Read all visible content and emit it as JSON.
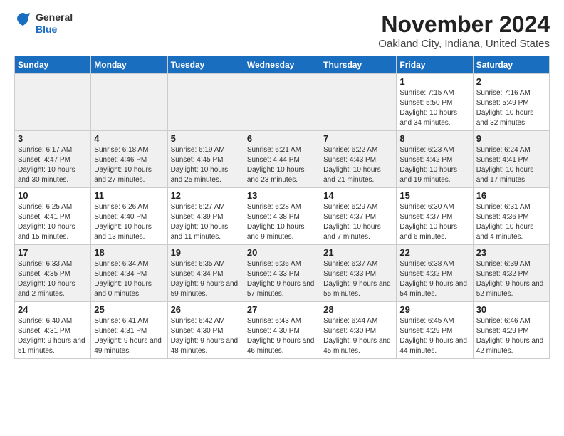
{
  "logo": {
    "line1": "General",
    "line2": "Blue"
  },
  "title": "November 2024",
  "location": "Oakland City, Indiana, United States",
  "days_of_week": [
    "Sunday",
    "Monday",
    "Tuesday",
    "Wednesday",
    "Thursday",
    "Friday",
    "Saturday"
  ],
  "weeks": [
    [
      {
        "day": "",
        "info": "",
        "empty": true
      },
      {
        "day": "",
        "info": "",
        "empty": true
      },
      {
        "day": "",
        "info": "",
        "empty": true
      },
      {
        "day": "",
        "info": "",
        "empty": true
      },
      {
        "day": "",
        "info": "",
        "empty": true
      },
      {
        "day": "1",
        "info": "Sunrise: 7:15 AM\nSunset: 5:50 PM\nDaylight: 10 hours\nand 34 minutes.",
        "empty": false
      },
      {
        "day": "2",
        "info": "Sunrise: 7:16 AM\nSunset: 5:49 PM\nDaylight: 10 hours\nand 32 minutes.",
        "empty": false
      }
    ],
    [
      {
        "day": "3",
        "info": "Sunrise: 6:17 AM\nSunset: 4:47 PM\nDaylight: 10 hours\nand 30 minutes.",
        "empty": false
      },
      {
        "day": "4",
        "info": "Sunrise: 6:18 AM\nSunset: 4:46 PM\nDaylight: 10 hours\nand 27 minutes.",
        "empty": false
      },
      {
        "day": "5",
        "info": "Sunrise: 6:19 AM\nSunset: 4:45 PM\nDaylight: 10 hours\nand 25 minutes.",
        "empty": false
      },
      {
        "day": "6",
        "info": "Sunrise: 6:21 AM\nSunset: 4:44 PM\nDaylight: 10 hours\nand 23 minutes.",
        "empty": false
      },
      {
        "day": "7",
        "info": "Sunrise: 6:22 AM\nSunset: 4:43 PM\nDaylight: 10 hours\nand 21 minutes.",
        "empty": false
      },
      {
        "day": "8",
        "info": "Sunrise: 6:23 AM\nSunset: 4:42 PM\nDaylight: 10 hours\nand 19 minutes.",
        "empty": false
      },
      {
        "day": "9",
        "info": "Sunrise: 6:24 AM\nSunset: 4:41 PM\nDaylight: 10 hours\nand 17 minutes.",
        "empty": false
      }
    ],
    [
      {
        "day": "10",
        "info": "Sunrise: 6:25 AM\nSunset: 4:41 PM\nDaylight: 10 hours\nand 15 minutes.",
        "empty": false
      },
      {
        "day": "11",
        "info": "Sunrise: 6:26 AM\nSunset: 4:40 PM\nDaylight: 10 hours\nand 13 minutes.",
        "empty": false
      },
      {
        "day": "12",
        "info": "Sunrise: 6:27 AM\nSunset: 4:39 PM\nDaylight: 10 hours\nand 11 minutes.",
        "empty": false
      },
      {
        "day": "13",
        "info": "Sunrise: 6:28 AM\nSunset: 4:38 PM\nDaylight: 10 hours\nand 9 minutes.",
        "empty": false
      },
      {
        "day": "14",
        "info": "Sunrise: 6:29 AM\nSunset: 4:37 PM\nDaylight: 10 hours\nand 7 minutes.",
        "empty": false
      },
      {
        "day": "15",
        "info": "Sunrise: 6:30 AM\nSunset: 4:37 PM\nDaylight: 10 hours\nand 6 minutes.",
        "empty": false
      },
      {
        "day": "16",
        "info": "Sunrise: 6:31 AM\nSunset: 4:36 PM\nDaylight: 10 hours\nand 4 minutes.",
        "empty": false
      }
    ],
    [
      {
        "day": "17",
        "info": "Sunrise: 6:33 AM\nSunset: 4:35 PM\nDaylight: 10 hours\nand 2 minutes.",
        "empty": false
      },
      {
        "day": "18",
        "info": "Sunrise: 6:34 AM\nSunset: 4:34 PM\nDaylight: 10 hours\nand 0 minutes.",
        "empty": false
      },
      {
        "day": "19",
        "info": "Sunrise: 6:35 AM\nSunset: 4:34 PM\nDaylight: 9 hours\nand 59 minutes.",
        "empty": false
      },
      {
        "day": "20",
        "info": "Sunrise: 6:36 AM\nSunset: 4:33 PM\nDaylight: 9 hours\nand 57 minutes.",
        "empty": false
      },
      {
        "day": "21",
        "info": "Sunrise: 6:37 AM\nSunset: 4:33 PM\nDaylight: 9 hours\nand 55 minutes.",
        "empty": false
      },
      {
        "day": "22",
        "info": "Sunrise: 6:38 AM\nSunset: 4:32 PM\nDaylight: 9 hours\nand 54 minutes.",
        "empty": false
      },
      {
        "day": "23",
        "info": "Sunrise: 6:39 AM\nSunset: 4:32 PM\nDaylight: 9 hours\nand 52 minutes.",
        "empty": false
      }
    ],
    [
      {
        "day": "24",
        "info": "Sunrise: 6:40 AM\nSunset: 4:31 PM\nDaylight: 9 hours\nand 51 minutes.",
        "empty": false
      },
      {
        "day": "25",
        "info": "Sunrise: 6:41 AM\nSunset: 4:31 PM\nDaylight: 9 hours\nand 49 minutes.",
        "empty": false
      },
      {
        "day": "26",
        "info": "Sunrise: 6:42 AM\nSunset: 4:30 PM\nDaylight: 9 hours\nand 48 minutes.",
        "empty": false
      },
      {
        "day": "27",
        "info": "Sunrise: 6:43 AM\nSunset: 4:30 PM\nDaylight: 9 hours\nand 46 minutes.",
        "empty": false
      },
      {
        "day": "28",
        "info": "Sunrise: 6:44 AM\nSunset: 4:30 PM\nDaylight: 9 hours\nand 45 minutes.",
        "empty": false
      },
      {
        "day": "29",
        "info": "Sunrise: 6:45 AM\nSunset: 4:29 PM\nDaylight: 9 hours\nand 44 minutes.",
        "empty": false
      },
      {
        "day": "30",
        "info": "Sunrise: 6:46 AM\nSunset: 4:29 PM\nDaylight: 9 hours\nand 42 minutes.",
        "empty": false
      }
    ]
  ]
}
